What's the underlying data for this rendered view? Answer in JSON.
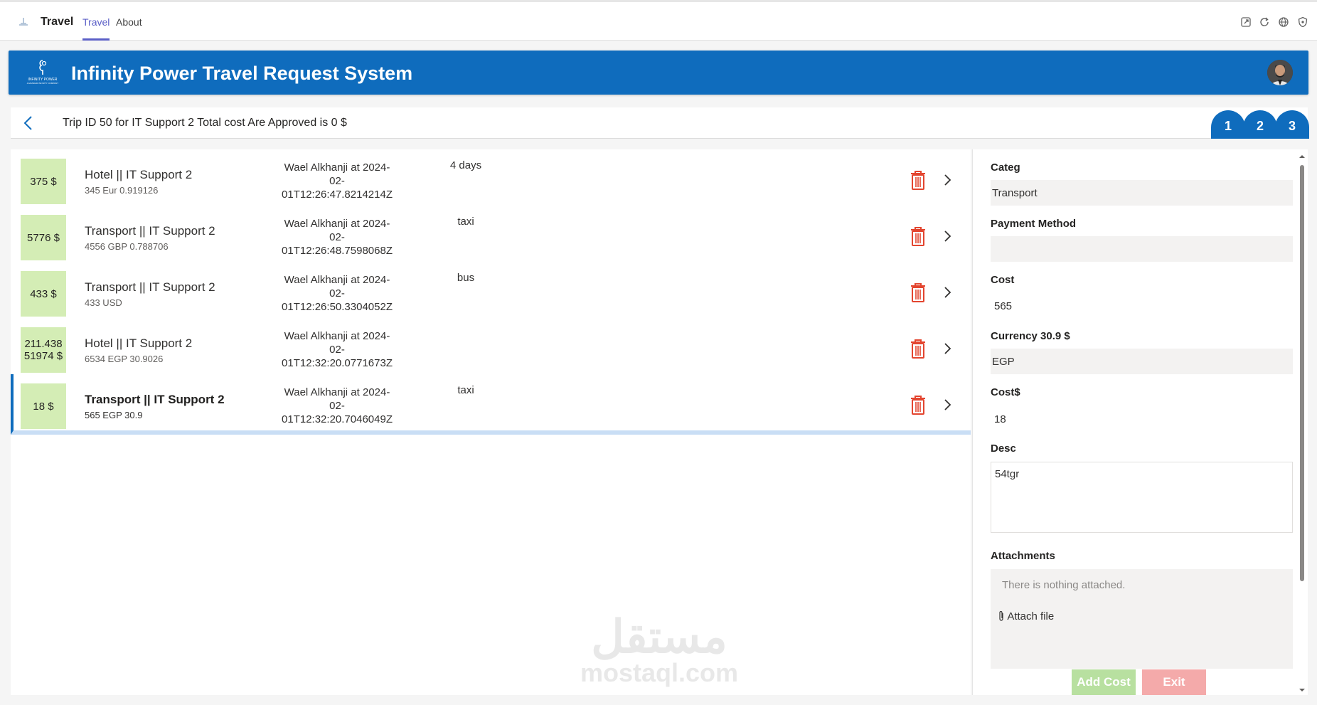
{
  "topbar": {
    "app_name": "Travel",
    "tabs": [
      "Travel",
      "About"
    ],
    "icons": [
      "popout-icon",
      "refresh-icon",
      "globe-icon",
      "shield-icon"
    ]
  },
  "banner": {
    "logo_alt": "INFINITY POWER",
    "title": "Infinity Power Travel Request System"
  },
  "header": {
    "trip_text": "Trip ID 50 for IT Support 2 Total cost Are Approved is 0 $",
    "steps": [
      "1",
      "2",
      "3"
    ]
  },
  "rows": [
    {
      "amount": [
        "375 $"
      ],
      "title": "Hotel || IT Support 2",
      "sub": "345 Eur 0.919126",
      "by": "Wael Alkhanji at 2024-02-01T12:26:47.8214214Z",
      "note": "4 days"
    },
    {
      "amount": [
        "5776 $"
      ],
      "title": "Transport || IT Support 2",
      "sub": "4556 GBP 0.788706",
      "by": "Wael Alkhanji at 2024-02-01T12:26:48.7598068Z",
      "note": "taxi"
    },
    {
      "amount": [
        "433 $"
      ],
      "title": "Transport || IT Support 2",
      "sub": "433 USD",
      "by": "Wael Alkhanji at 2024-02-01T12:26:50.3304052Z",
      "note": "bus"
    },
    {
      "amount": [
        "211.438",
        "51974 $"
      ],
      "title": "Hotel || IT Support 2",
      "sub": "6534 EGP 30.9026",
      "by": "Wael Alkhanji at 2024-02-01T12:32:20.0771673Z",
      "note": ""
    },
    {
      "amount": [
        "18 $"
      ],
      "title": "Transport || IT Support 2",
      "sub": "565 EGP 30.9",
      "by": "Wael Alkhanji at 2024-02-01T12:32:20.7046049Z",
      "note": "taxi"
    }
  ],
  "form": {
    "categ_label": "Categ",
    "categ_value": "Transport",
    "payment_label": "Payment Method",
    "payment_value": "",
    "cost_label": "Cost",
    "cost_value": "565",
    "currency_label": "Currency 30.9 $",
    "currency_value": "EGP",
    "costusd_label": "Cost$",
    "costusd_value": "18",
    "desc_label": "Desc",
    "desc_value": "54tgr",
    "attachments_label": "Attachments",
    "attachments_empty": "There is nothing attached.",
    "attach_file_label": "Attach file"
  },
  "buttons": {
    "add_cost": "Add Cost",
    "exit": "Exit"
  },
  "watermark": {
    "arabic": "مستقل",
    "latin": "mostaql.com"
  },
  "colors": {
    "brand_blue": "#0f6cbd",
    "amount_green": "#d4edb5",
    "delete_red": "#e3452f",
    "add_green": "#b8e0a0",
    "exit_red": "#f4aaaa"
  }
}
